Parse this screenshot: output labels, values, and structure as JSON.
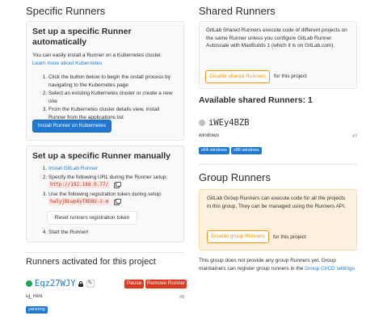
{
  "specific": {
    "title": "Specific Runners",
    "auto": {
      "heading": "Set up a specific Runner automatically",
      "desc": "You can easily install a Runner on a Kubernetes cluster.",
      "learn_more": "Learn more about Kubernetes",
      "steps": [
        "Click the button below to begin the install process by navigating to the Kubernetes page",
        "Select an existing Kubernetes cluster or create a new one",
        "From the Kubernetes cluster details view, install Runner from the applications list"
      ],
      "button": "Install Runner on Kubernetes"
    },
    "manual": {
      "heading": "Set up a specific Runner manually",
      "step1_link": "Install GitLab Runner",
      "step2": "Specify the following URL during the Runner setup:",
      "url": "http://192.168.0.77/",
      "step3": "Use the following registration token during setup:",
      "token": "hw5yjBLwpAyT8D8U-z-m",
      "reset_button": "Reset runners registration token",
      "step4": "Start the Runner!"
    },
    "activated": {
      "title": "Runners activated for this project",
      "runner_id": "Eqz27WJY",
      "description": "uj_mini",
      "number": "#8",
      "tag": "yanzeng",
      "pause": "Pause",
      "remove": "Remove Runner"
    }
  },
  "shared": {
    "title": "Shared Runners",
    "desc": "GitLab Shared Runners execute code of different projects on the same Runner unless you configure GitLab Runner Autoscale with MaxBuilds 1 (which it is on GitLab.com).",
    "disable_button": "Disable shared Runners",
    "for_project": "for this project",
    "available_title": "Available shared Runners: 1",
    "runner_id": "iWEy4BZB",
    "description": "windows",
    "number": "#7",
    "tags": [
      "x64-windows",
      "x86-windows"
    ]
  },
  "group": {
    "title": "Group Runners",
    "desc": "GitLab Group Runners can execute code for all the projects in this group. They can be managed using the Runners API.",
    "disable_button": "Disable group Runners",
    "for_project": "for this project",
    "note_prefix": "This group does not provide any group Runners yet. Group maintainers can register group runners in the",
    "note_link": "Group CI/CD settings"
  },
  "colors": {
    "link": "#1f78d1",
    "status_online": "#1aaa55",
    "status_paused": "#bfbfbf",
    "warning_bg": "#fdf1dd",
    "danger": "#db3b21"
  }
}
